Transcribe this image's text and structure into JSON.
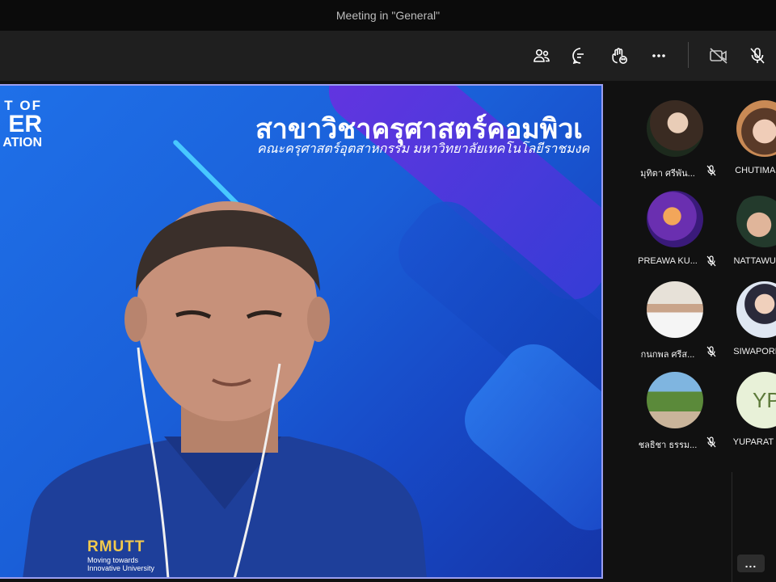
{
  "window": {
    "title": "Meeting in \"General\""
  },
  "toolbar": {
    "buttons": [
      {
        "icon": "participants-icon",
        "name": "show-participants-button"
      },
      {
        "icon": "chat-icon",
        "name": "show-conversation-button"
      },
      {
        "icon": "raise-hand-icon",
        "name": "reactions-button"
      },
      {
        "icon": "more-actions-icon",
        "name": "more-actions-button"
      },
      {
        "icon": "camera-off-icon",
        "name": "camera-toggle-button"
      },
      {
        "icon": "mic-off-icon",
        "name": "mic-toggle-button"
      }
    ]
  },
  "main_video": {
    "background_text": {
      "dept_line1": "T OF",
      "dept_line2": "ER",
      "dept_line3": "ATION",
      "headline": "สาขาวิชาครุศาสตร์คอมพิวเ",
      "subline": "คณะครุศาสตร์อุตสาหกรรม มหาวิทยาลัยเทคโนโลยีราชมงค"
    },
    "shirt_logo": {
      "brand": "RMUTT",
      "tagline1": "Moving towards",
      "tagline2": "Innovative University"
    }
  },
  "participants": [
    {
      "name": "มุทิตา ศรีพัน...",
      "muted": true,
      "avatar": "photo"
    },
    {
      "name": "CHUTIMA I",
      "muted": false,
      "avatar": "photo"
    },
    {
      "name": "PREAWA KU...",
      "muted": true,
      "avatar": "photo"
    },
    {
      "name": "NATTAWUT",
      "muted": false,
      "avatar": "photo"
    },
    {
      "name": "กนกพล ศรีส...",
      "muted": true,
      "avatar": "photo"
    },
    {
      "name": "SIWAPORN",
      "muted": false,
      "avatar": "photo"
    },
    {
      "name": "ชลธิชา ธรรม...",
      "muted": true,
      "avatar": "photo"
    },
    {
      "name": "YUPARAT P",
      "muted": false,
      "avatar": "initials",
      "initials": "YP"
    }
  ],
  "footer": {
    "more_label": "..."
  },
  "colors": {
    "accent": "#9a9ef0",
    "initials_bg": "#e8f1d8",
    "initials_fg": "#5d7a3a"
  }
}
